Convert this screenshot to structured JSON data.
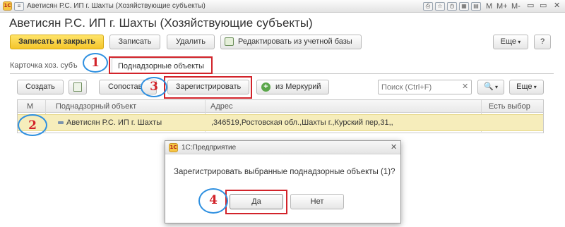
{
  "window": {
    "title": "Аветисян Р.С. ИП г. Шахты (Хозяйствующие субъекты)",
    "controls": [
      "M",
      "M+",
      "M-"
    ]
  },
  "heading": "Аветисян Р.С. ИП г. Шахты (Хозяйствующие субъекты)",
  "toolbar": {
    "save_close": "Записать и закрыть",
    "save": "Записать",
    "delete": "Удалить",
    "edit_from_base": "Редактировать из учетной базы",
    "more": "Еще",
    "help": "?"
  },
  "tabs": [
    {
      "label": "Карточка хоз. субъ"
    },
    {
      "label": "Поднадзорные объекты"
    }
  ],
  "subtoolbar": {
    "create": "Создать",
    "compare": "Сопостав",
    "register": "Зарегистрировать",
    "from_mercury": "из Меркурий",
    "search_placeholder": "Поиск (Ctrl+F)",
    "more": "Еще"
  },
  "table": {
    "columns": [
      "М",
      "Поднадзорный объект",
      "Адрес",
      "Есть выбор"
    ],
    "rows": [
      {
        "object": "Аветисян Р.С. ИП г. Шахты",
        "address": ",346519,Ростовская обл.,Шахты г.,Курский пер,31,,"
      }
    ]
  },
  "dialog": {
    "title": "1С:Предприятие",
    "message": "Зарегистрировать выбранные поднадзорные объекты (1)?",
    "yes": "Да",
    "no": "Нет"
  },
  "annotations": [
    "1",
    "2",
    "3",
    "4"
  ],
  "colors": {
    "annotation_red": "#d2232a",
    "annotation_blue": "#2d8fe0",
    "primary_button": "#f4c52a",
    "selected_row": "#f6edbb"
  }
}
